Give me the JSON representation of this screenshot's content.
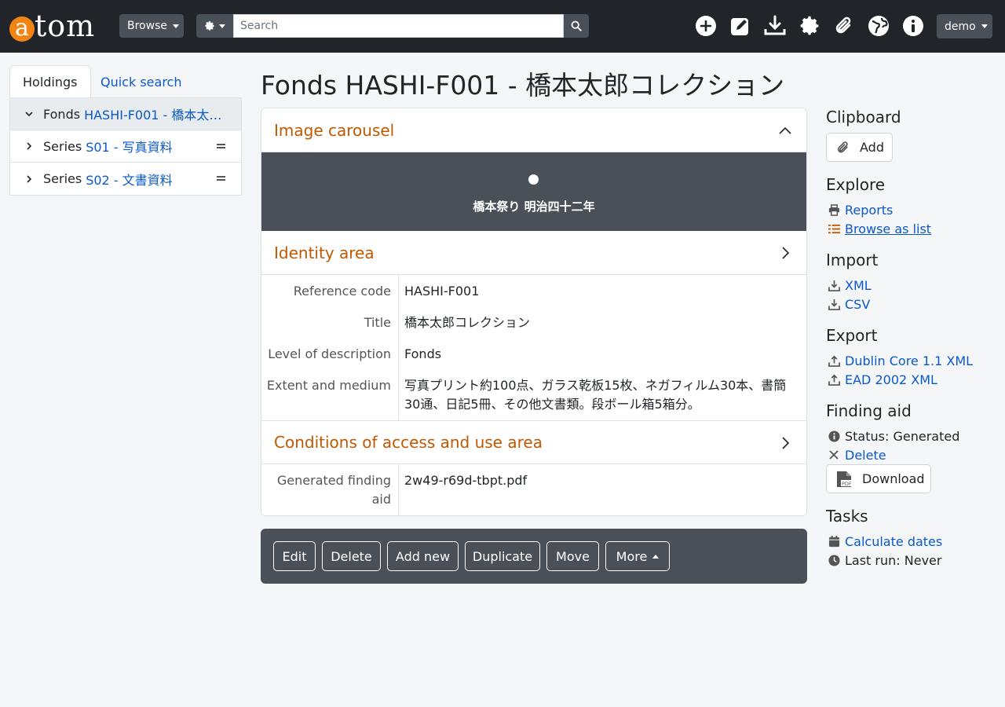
{
  "header": {
    "logo_first": "a",
    "logo_rest": "tom",
    "browse_label": "Browse",
    "search_placeholder": "Search",
    "user_label": "demo",
    "nav_icons": [
      "plus-circle-icon",
      "edit-icon",
      "download-icon",
      "gear-icon",
      "paperclip-icon",
      "globe-icon",
      "info-icon"
    ]
  },
  "left": {
    "tabs": [
      {
        "label": "Holdings",
        "active": true
      },
      {
        "label": "Quick search",
        "active": false
      }
    ],
    "tree": [
      {
        "type": "Fonds",
        "title": "HASHI-F001 - 橋本太郎...",
        "expanded": true,
        "active": true
      },
      {
        "type": "Series",
        "title": "S01 - 写真資料",
        "expanded": false,
        "active": false
      },
      {
        "type": "Series",
        "title": "S02 - 文書資料",
        "expanded": false,
        "active": false
      }
    ]
  },
  "main": {
    "page_title": "Fonds HASHI-F001 - 橋本太郎コレクション",
    "carousel": {
      "heading": "Image carousel",
      "caption": "橋本祭り 明治四十二年"
    },
    "identity": {
      "heading": "Identity area",
      "fields": [
        {
          "label": "Reference code",
          "value": "HASHI-F001"
        },
        {
          "label": "Title",
          "value": "橋本太郎コレクション"
        },
        {
          "label": "Level of description",
          "value": "Fonds"
        },
        {
          "label": "Extent and medium",
          "value": "写真プリント約100点、ガラス乾板15枚、ネガフィルム30本、書簡30通、日記5冊、その他文書類。段ボール箱5箱分。"
        }
      ]
    },
    "access": {
      "heading": "Conditions of access and use area",
      "fields": [
        {
          "label": "Generated finding aid",
          "value": "2w49-r69d-tbpt.pdf"
        }
      ]
    },
    "actions": [
      "Edit",
      "Delete",
      "Add new",
      "Duplicate",
      "Move",
      "More"
    ]
  },
  "sidebar": {
    "clipboard": {
      "heading": "Clipboard",
      "add_label": "Add"
    },
    "explore": {
      "heading": "Explore",
      "reports": "Reports",
      "browse_list": "Browse as list"
    },
    "import": {
      "heading": "Import",
      "xml": "XML",
      "csv": "CSV"
    },
    "export": {
      "heading": "Export",
      "dc": "Dublin Core 1.1 XML",
      "ead": "EAD 2002 XML"
    },
    "finding_aid": {
      "heading": "Finding aid",
      "status": "Status: Generated",
      "delete": "Delete",
      "download": "Download",
      "pdf_badge": "PDF"
    },
    "tasks": {
      "heading": "Tasks",
      "calculate": "Calculate dates",
      "last_run": "Last run: Never"
    }
  },
  "colors": {
    "accent": "#c05800",
    "link": "#0a58ca",
    "header_bg": "#212529",
    "logo_orange": "#f28413",
    "panel_dark": "#495057"
  }
}
